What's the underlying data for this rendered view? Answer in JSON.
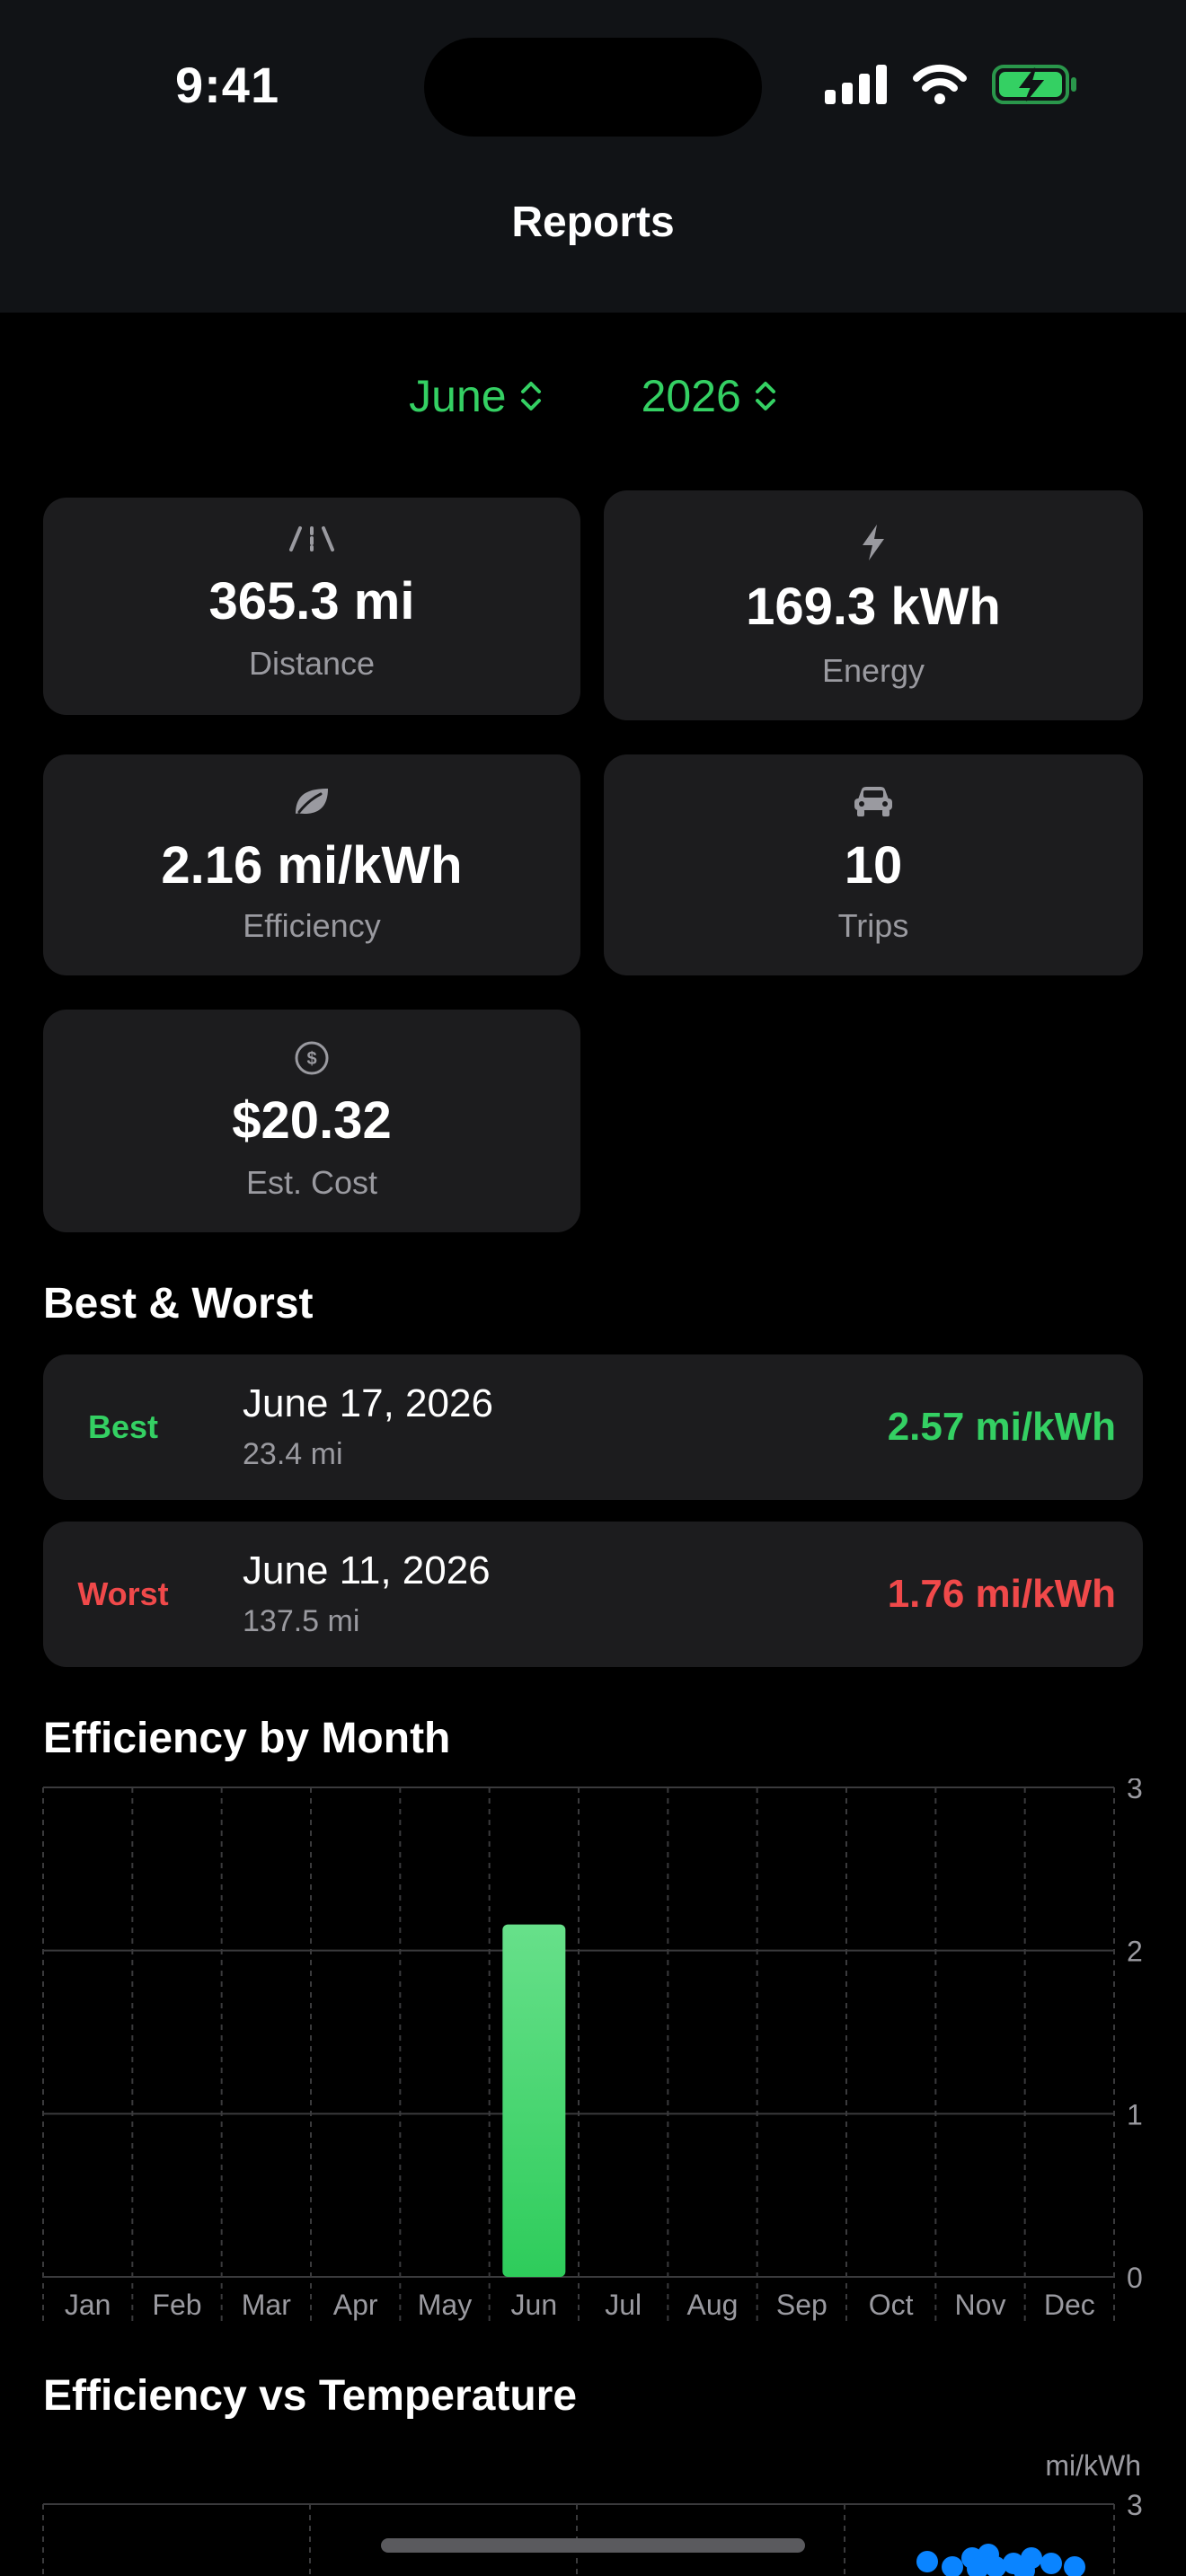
{
  "status": {
    "time": "9:41"
  },
  "nav": {
    "title": "Reports"
  },
  "pickers": {
    "month": "June",
    "year": "2026"
  },
  "stats": [
    {
      "icon": "road-icon",
      "value": "365.3 mi",
      "label": "Distance"
    },
    {
      "icon": "bolt-icon",
      "value": "169.3 kWh",
      "label": "Energy"
    },
    {
      "icon": "leaf-icon",
      "value": "2.16 mi/kWh",
      "label": "Efficiency"
    },
    {
      "icon": "car-icon",
      "value": "10",
      "label": "Trips"
    },
    {
      "icon": "dollar-circle-icon",
      "value": "$20.32",
      "label": "Est. Cost"
    }
  ],
  "best_worst": {
    "title": "Best & Worst",
    "best": {
      "tag": "Best",
      "date": "June 17, 2026",
      "distance": "23.4 mi",
      "efficiency": "2.57 mi/kWh"
    },
    "worst": {
      "tag": "Worst",
      "date": "June 11, 2026",
      "distance": "137.5 mi",
      "efficiency": "1.76 mi/kWh"
    }
  },
  "colors": {
    "accent": "#34d063",
    "worst": "#f0494a",
    "card": "#1c1c1e",
    "scatter": "#0a84ff"
  },
  "chart_data": [
    {
      "type": "bar",
      "title": "Efficiency by Month",
      "categories": [
        "Jan",
        "Feb",
        "Mar",
        "Apr",
        "May",
        "Jun",
        "Jul",
        "Aug",
        "Sep",
        "Oct",
        "Nov",
        "Dec"
      ],
      "values": [
        null,
        null,
        null,
        null,
        null,
        2.16,
        null,
        null,
        null,
        null,
        null,
        null
      ],
      "ylim": [
        0,
        3
      ],
      "yticks": [
        "0",
        "1",
        "2",
        "3"
      ],
      "grid": true
    },
    {
      "type": "scatter",
      "title": "Efficiency vs Temperature",
      "ylabel": "mi/kWh",
      "ytick_top": "3",
      "ylim": [
        0,
        3
      ]
    }
  ]
}
